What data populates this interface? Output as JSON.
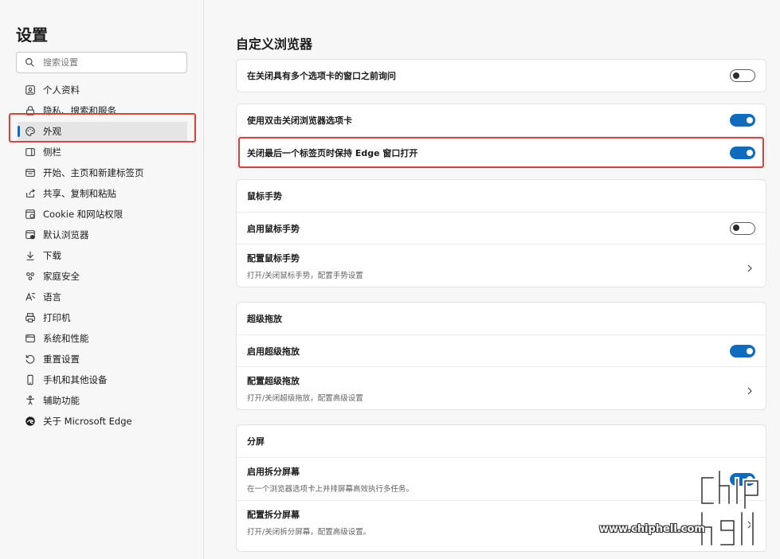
{
  "sidebar": {
    "title": "设置",
    "search_placeholder": "搜索设置",
    "items": [
      {
        "label": "个人资料",
        "icon": "profile-icon"
      },
      {
        "label": "隐私、搜索和服务",
        "icon": "lock-icon"
      },
      {
        "label": "外观",
        "icon": "palette-icon",
        "active": true
      },
      {
        "label": "侧栏",
        "icon": "sidebar-icon"
      },
      {
        "label": "开始、主页和新建标签页",
        "icon": "home-tabs-icon"
      },
      {
        "label": "共享、复制和粘贴",
        "icon": "share-icon"
      },
      {
        "label": "Cookie 和网站权限",
        "icon": "cookie-icon"
      },
      {
        "label": "默认浏览器",
        "icon": "default-browser-icon"
      },
      {
        "label": "下载",
        "icon": "download-icon"
      },
      {
        "label": "家庭安全",
        "icon": "family-icon"
      },
      {
        "label": "语言",
        "icon": "language-icon"
      },
      {
        "label": "打印机",
        "icon": "printer-icon"
      },
      {
        "label": "系统和性能",
        "icon": "system-icon"
      },
      {
        "label": "重置设置",
        "icon": "reset-icon"
      },
      {
        "label": "手机和其他设备",
        "icon": "phone-icon"
      },
      {
        "label": "辅助功能",
        "icon": "accessibility-icon"
      },
      {
        "label": "关于 Microsoft Edge",
        "icon": "edge-icon"
      }
    ]
  },
  "main": {
    "title": "自定义浏览器",
    "card1": {
      "label": "在关闭具有多个选项卡的窗口之前询问",
      "toggle": "off"
    },
    "card2": {
      "row1": {
        "label": "使用双击关闭浏览器选项卡",
        "toggle": "on"
      },
      "row2": {
        "label": "关闭最后一个标签页时保持 Edge 窗口打开",
        "toggle": "on"
      }
    },
    "mouse": {
      "head": "鼠标手势",
      "enable": {
        "label": "启用鼠标手势",
        "toggle": "off"
      },
      "config": {
        "label": "配置鼠标手势",
        "sub": "打开/关闭鼠标手势，配置手势设置"
      }
    },
    "drag": {
      "head": "超级拖放",
      "enable": {
        "label": "启用超级拖放",
        "toggle": "on"
      },
      "config": {
        "label": "配置超级拖放",
        "sub": "打开/关闭超级拖放，配置高级设置"
      }
    },
    "split": {
      "head": "分屏",
      "enable": {
        "label": "启用拆分屏幕",
        "sub": "在一个浏览器选项卡上并排屏幕高效执行多任务。",
        "toggle": "on"
      },
      "config": {
        "label": "配置拆分屏幕",
        "sub": "打开/关闭拆分屏幕，配置高级设置。"
      }
    }
  },
  "watermark": {
    "site": "www.chiphell.com"
  },
  "colors": {
    "accent": "#0f6cbd",
    "highlight": "#e33a3a"
  }
}
